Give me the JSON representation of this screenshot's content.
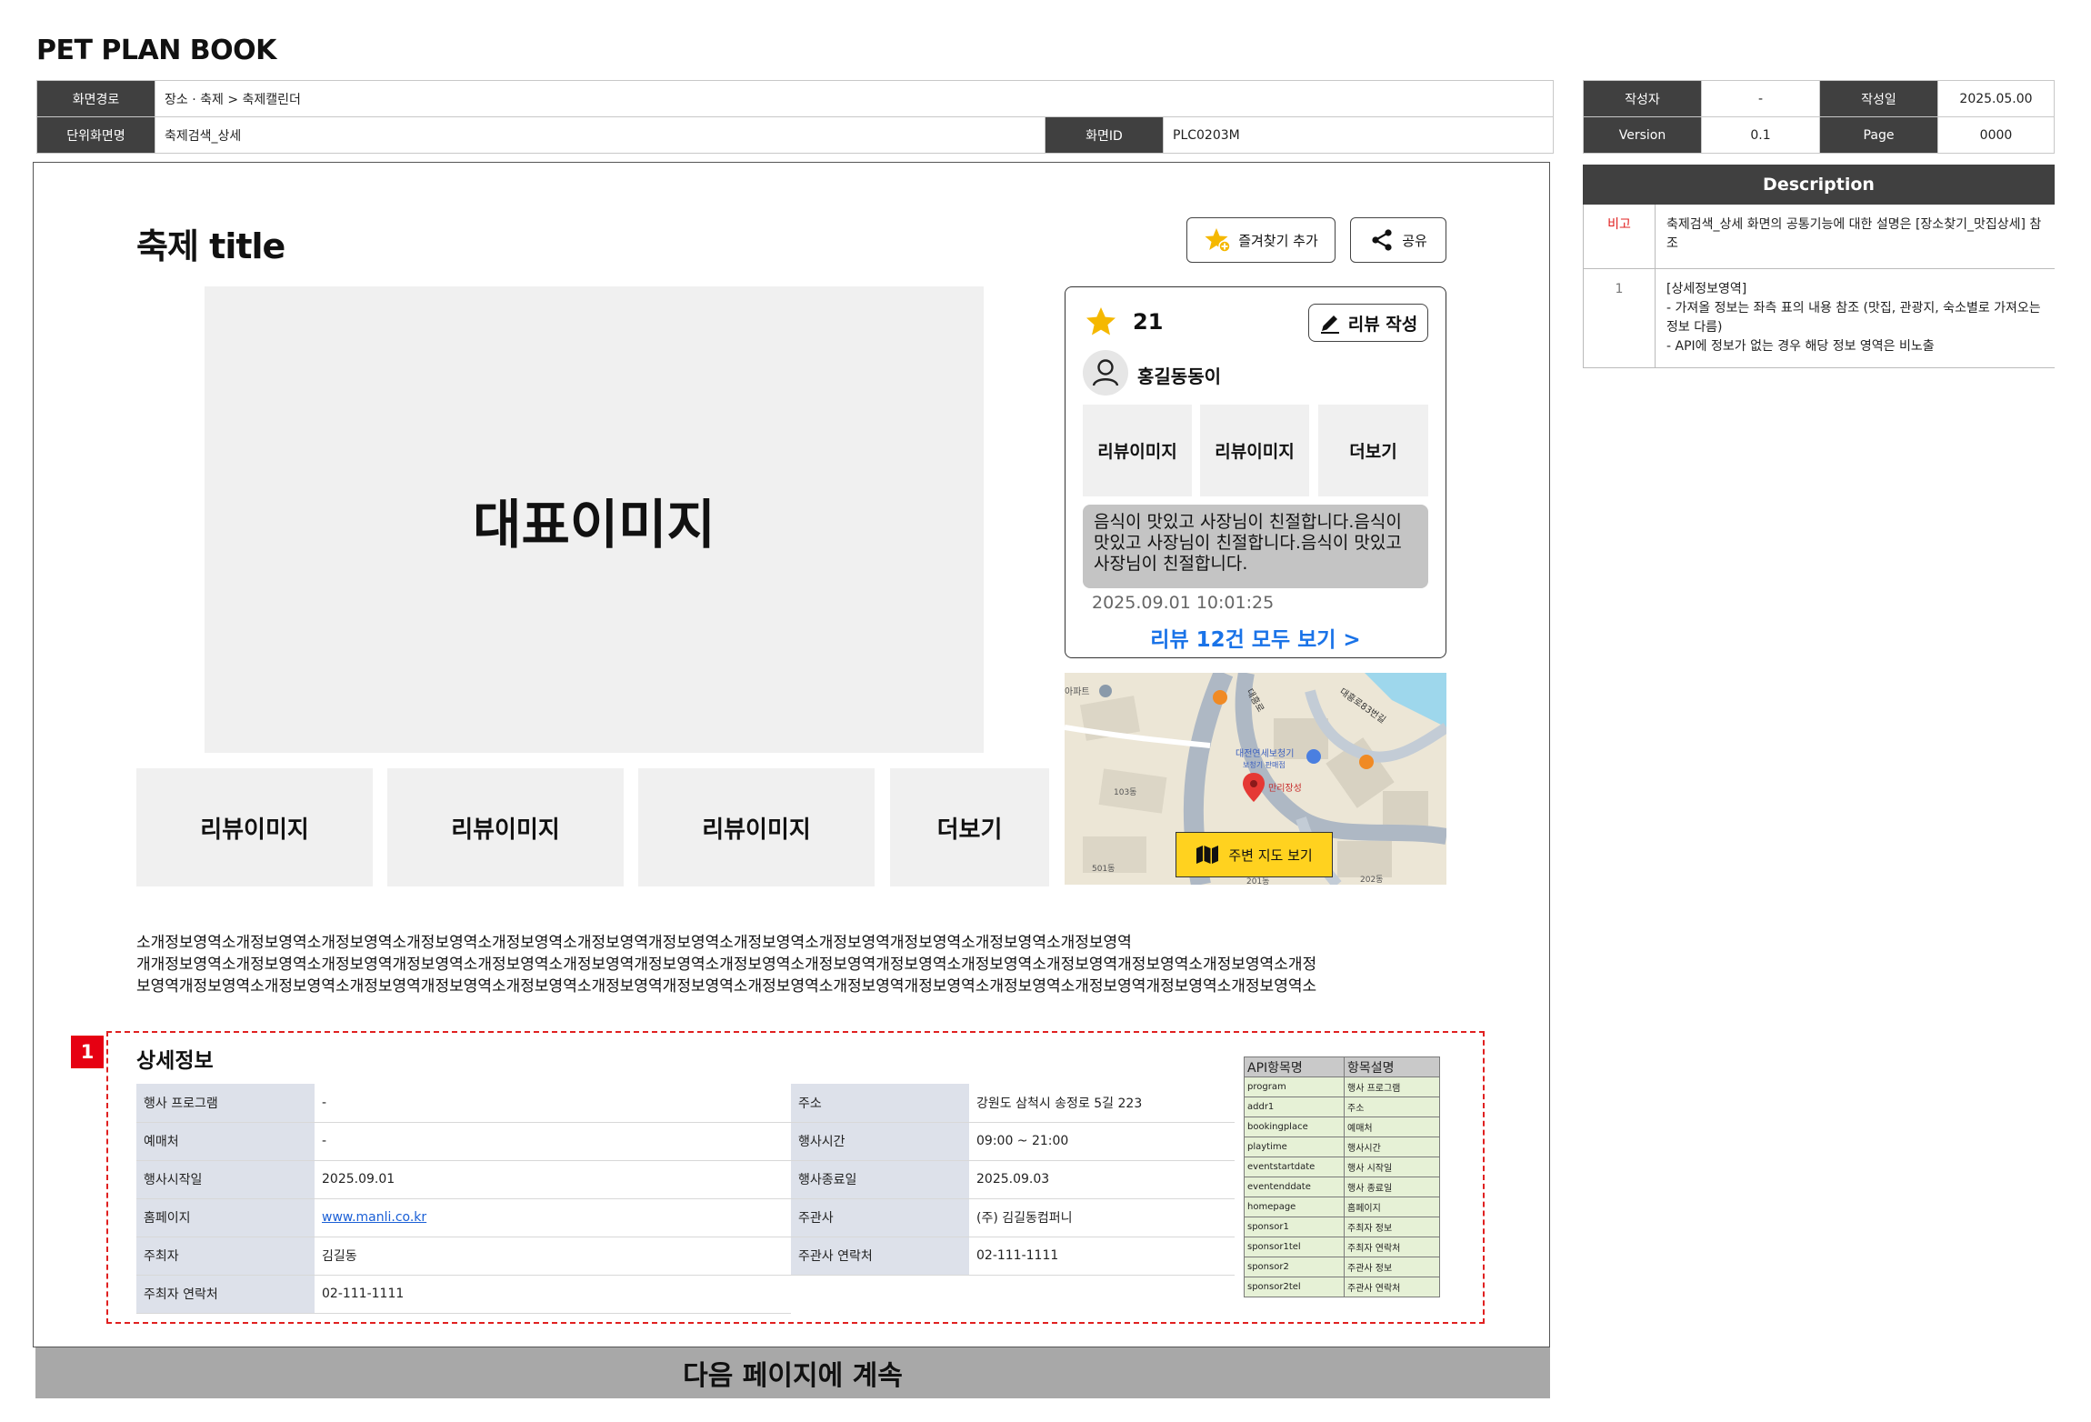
{
  "doc_title": "PET PLAN BOOK",
  "header": {
    "path_label": "화면경로",
    "path_value": "장소 · 축제 > 축제캘린더",
    "unit_label": "단위화면명",
    "unit_value": "축제검색_상세",
    "screen_id_label": "화면ID",
    "screen_id_value": "PLC0203M"
  },
  "meta": {
    "author_label": "작성자",
    "author_value": "-",
    "date_label": "작성일",
    "date_value": "2025.05.00",
    "version_label": "Version",
    "version_value": "0.1",
    "page_label": "Page",
    "page_value": "0000"
  },
  "festival": {
    "title": "축제 title",
    "favorite_button": "즐겨찾기 추가",
    "share_button": "공유",
    "main_image": "대표이미지",
    "thumbs": [
      "리뷰이미지",
      "리뷰이미지",
      "리뷰이미지"
    ],
    "more": "더보기"
  },
  "review": {
    "rating": "21",
    "write_button": "리뷰 작성",
    "user_name": "홍길동동이",
    "thumbs": [
      "리뷰이미지",
      "리뷰이미지"
    ],
    "more": "더보기",
    "text": "음식이 맛있고 사장님이 친절합니다.음식이 맛있고 사장님이 친절합니다.음식이 맛있고 사장님이 친절합니다.",
    "date": "2025.09.01 10:01:25",
    "view_all": "리뷰 12건 모두 보기 >"
  },
  "map": {
    "button": "주변 지도 보기",
    "labels": {
      "apartment": "아파트",
      "building": "대전연세보청기",
      "building_sub": "보청기 판매점",
      "pin": "만리장성",
      "b103": "103동",
      "b501": "501동",
      "b201": "201동",
      "b202": "202동",
      "road1": "대흥로",
      "road2": "대흥로83번길"
    }
  },
  "intro": {
    "lines": [
      "소개정보영역소개정보영역소개정보영역소개정보영역소개정보영역소개정보영역개정보영역소개정보영역소개정보영역개정보영역소개정보영역소개정보영역",
      "개개정보영역소개정보영역소개정보영역개정보영역소개정보영역소개정보영역개정보영역소개정보영역소개정보영역개정보영역소개정보영역소개정보영역개정보영역소개정보영역소개정",
      "보영역개정보영역소개정보영역소개정보영역개정보영역소개정보영역소개정보영역개정보영역소개정보영역소개정보영역개정보영역소개정보영역소개정보영역개정보영역소개정보영역소"
    ]
  },
  "detail": {
    "badge": "1",
    "title": "상세정보",
    "rows": [
      {
        "l1": "행사 프로그램",
        "v1": "-",
        "l2": "주소",
        "v2": "강원도 삼척시 송정로 5길 223"
      },
      {
        "l1": "예매처",
        "v1": "-",
        "l2": "행사시간",
        "v2": "09:00 ~ 21:00"
      },
      {
        "l1": "행사시작일",
        "v1": "2025.09.01",
        "l2": "행사종료일",
        "v2": "2025.09.03"
      },
      {
        "l1": "홈페이지",
        "v1": "www.manli.co.kr",
        "l2": "주관사",
        "v2": "(주) 김길동컴퍼니"
      },
      {
        "l1": "주최자",
        "v1": "김길동",
        "l2": "주관사 연락처",
        "v2": "02-111-1111"
      },
      {
        "l1": "주최자 연락처",
        "v1": "02-111-1111",
        "l2": "",
        "v2": ""
      }
    ],
    "api_header": [
      "API항목명",
      "항목설명"
    ],
    "api_rows": [
      [
        "program",
        "행사 프로그램"
      ],
      [
        "addr1",
        "주소"
      ],
      [
        "bookingplace",
        "예매처"
      ],
      [
        "playtime",
        "행사시간"
      ],
      [
        "eventstartdate",
        "행사 시작일"
      ],
      [
        "eventenddate",
        "행사 종료일"
      ],
      [
        "homepage",
        "홈페이지"
      ],
      [
        "sponsor1",
        "주최자 정보"
      ],
      [
        "sponsor1tel",
        "주최자 연락처"
      ],
      [
        "sponsor2",
        "주관사 정보"
      ],
      [
        "sponsor2tel",
        "주관사 연락처"
      ]
    ]
  },
  "continue_text": "다음 페이지에 계속",
  "description": {
    "header": "Description",
    "items": [
      {
        "key": "비고",
        "text": "축제검색_상세 화면의 공통기능에 대한 설명은 [장소찾기_맛집상세] 참조"
      },
      {
        "key": "1",
        "text_lines": [
          "[상세정보영역]",
          "- 가져올 정보는 좌측 표의 내용 참조 (맛집, 관광지, 숙소별로 가져오는 정보 다름)",
          "- API에 정보가 없는 경우 해당 정보 영역은 비노출"
        ]
      }
    ]
  },
  "colors": {
    "header_dark": "#404040",
    "accent_blue": "#1a73e8",
    "badge_red": "#e60012",
    "map_button": "#ffd21f",
    "note_red": "#e02020"
  }
}
